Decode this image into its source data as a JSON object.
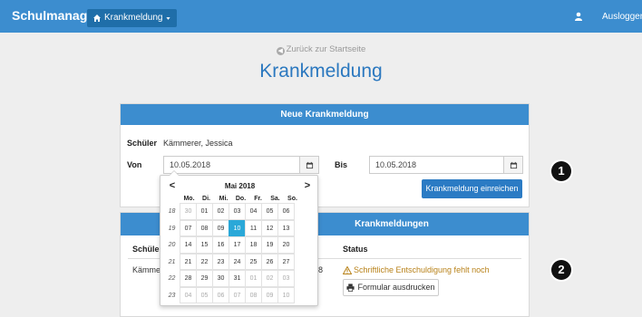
{
  "navbar": {
    "brand": "Schulmanager",
    "menu_label": "Krankmeldung",
    "logout_label": "Ausloggen"
  },
  "header": {
    "back_link": "Zurück zur Startseite",
    "title": "Krankmeldung"
  },
  "form": {
    "heading": "Neue Krankmeldung",
    "student_label": "Schüler",
    "student_value": "Kämmerer, Jessica",
    "from_label": "Von",
    "from_value": "10.05.2018",
    "to_label": "Bis",
    "to_value": "10.05.2018",
    "submit_label": "Krankmeldung einreichen"
  },
  "list": {
    "heading_fragment": "Krankmeldungen",
    "col_student": "Schüler",
    "col_status": "Status",
    "row_student_fragment": "Kämmerer",
    "row_date_fragment": "8",
    "row_status": "Schriftliche Entschuldigung fehlt noch",
    "print_label": "Formular ausdrucken"
  },
  "badges": [
    "1",
    "2"
  ],
  "datepicker": {
    "month": "Mai 2018",
    "prev": "<",
    "next": ">",
    "weekdays": [
      "Mo.",
      "Di.",
      "Mi.",
      "Do.",
      "Fr.",
      "Sa.",
      "So."
    ],
    "selected_day": "10",
    "weeks": [
      {
        "week": "18",
        "days": [
          "30",
          "01",
          "02",
          "03",
          "04",
          "05",
          "06"
        ],
        "muted": [
          0
        ]
      },
      {
        "week": "19",
        "days": [
          "07",
          "08",
          "09",
          "10",
          "11",
          "12",
          "13"
        ],
        "muted": []
      },
      {
        "week": "20",
        "days": [
          "14",
          "15",
          "16",
          "17",
          "18",
          "19",
          "20"
        ],
        "muted": []
      },
      {
        "week": "21",
        "days": [
          "21",
          "22",
          "23",
          "24",
          "25",
          "26",
          "27"
        ],
        "muted": []
      },
      {
        "week": "22",
        "days": [
          "28",
          "29",
          "30",
          "31",
          "01",
          "02",
          "03"
        ],
        "muted": [
          4,
          5,
          6
        ]
      },
      {
        "week": "23",
        "days": [
          "04",
          "05",
          "06",
          "07",
          "08",
          "09",
          "10"
        ],
        "muted": [
          0,
          1,
          2,
          3,
          4,
          5,
          6
        ]
      }
    ]
  },
  "colors": {
    "primary": "#3c8dcf",
    "selected_day": "#2aa8d8",
    "warning": "#b8821a"
  }
}
